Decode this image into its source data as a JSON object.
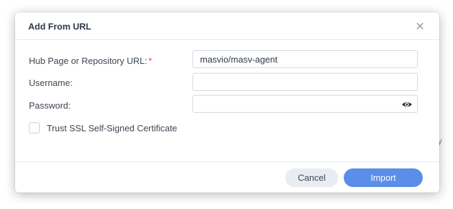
{
  "dialog": {
    "title": "Add From URL",
    "close_icon": "close-icon"
  },
  "form": {
    "url": {
      "label": "Hub Page or Repository URL:",
      "required_mark": "*",
      "value": "masvio/masv-agent"
    },
    "username": {
      "label": "Username:",
      "value": ""
    },
    "password": {
      "label": "Password:",
      "value": "",
      "toggle_icon": "eye-icon"
    },
    "trust_ssl": {
      "label": "Trust SSL Self-Signed Certificate",
      "checked": false
    }
  },
  "footer": {
    "cancel_label": "Cancel",
    "import_label": "Import"
  },
  "background": {
    "partial_glyph": "y"
  },
  "colors": {
    "accent": "#5a8ee8",
    "required": "#e2463b",
    "cancel_bg": "#e9edf1"
  }
}
